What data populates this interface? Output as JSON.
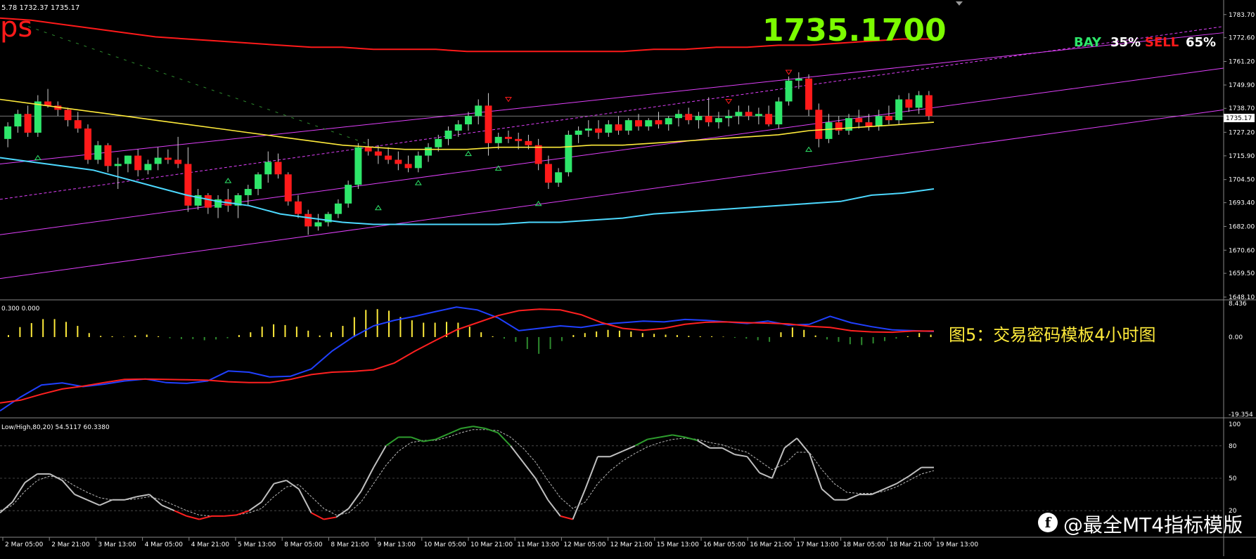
{
  "header": {
    "ohlc_text": "5.78 1732.37 1735.17",
    "brand_fragment": "ps",
    "current_price": "1735.1700",
    "bay_label": "BAY",
    "bay_value": "35%",
    "sell_label": "SELL",
    "sell_value": "65%",
    "price_tag": "1735.17"
  },
  "macd_panel": {
    "header": "0.300 0.000",
    "caption": "图5：交易密码模板4小时图"
  },
  "stoch_panel": {
    "header": "Low/High,80,20) 54.5117 60.3380"
  },
  "watermark": {
    "logo_glyph": "f",
    "text": "@最全MT4指标模版"
  },
  "colors": {
    "bull": "#2ee66a",
    "bear": "#ff1a1a",
    "ma_red": "#ff1a1a",
    "ma_yellow": "#ffeb3b",
    "ma_cyan": "#4dd9ff",
    "channel": "#e040fb",
    "price_big": "#7cfc00",
    "macd_hist": "#ffeb3b",
    "macd_hist_neg": "#2e8b2e",
    "macd_signal": "#ff2020",
    "macd_line": "#2040ff",
    "stoch_main": "#c0c0c0",
    "stoch_over": "#2e9e2e",
    "stoch_under": "#ff2020"
  },
  "chart_data": [
    {
      "type": "candlestick",
      "price_axis": [
        "1783.70",
        "1772.60",
        "1761.20",
        "1749.90",
        "1738.70",
        "1727.20",
        "1715.90",
        "1704.50",
        "1693.40",
        "1682.00",
        "1670.60",
        "1659.50",
        "1648.10"
      ],
      "ylim": [
        1648.1,
        1788.0
      ],
      "time_axis": [
        "2 Mar 05:00",
        "2 Mar 21:00",
        "3 Mar 13:00",
        "4 Mar 05:00",
        "4 Mar 21:00",
        "5 Mar 13:00",
        "8 Mar 05:00",
        "8 Mar 21:00",
        "9 Mar 13:00",
        "10 Mar 05:00",
        "10 Mar 21:00",
        "11 Mar 13:00",
        "12 Mar 05:00",
        "12 Mar 21:00",
        "15 Mar 13:00",
        "16 Mar 05:00",
        "16 Mar 21:00",
        "17 Mar 13:00",
        "18 Mar 05:00",
        "18 Mar 21:00",
        "19 Mar 13:00"
      ],
      "candles_ohlc": [
        [
          1724,
          1732,
          1720,
          1730
        ],
        [
          1730,
          1738,
          1727,
          1736
        ],
        [
          1736,
          1740,
          1725,
          1727
        ],
        [
          1727,
          1745,
          1725,
          1742
        ],
        [
          1742,
          1748,
          1739,
          1740
        ],
        [
          1740,
          1742,
          1735,
          1738
        ],
        [
          1738,
          1739,
          1730,
          1733
        ],
        [
          1733,
          1737,
          1727,
          1729
        ],
        [
          1729,
          1731,
          1712,
          1714
        ],
        [
          1714,
          1723,
          1712,
          1721
        ],
        [
          1721,
          1722,
          1708,
          1711
        ],
        [
          1711,
          1715,
          1700,
          1712
        ],
        [
          1712,
          1716,
          1708,
          1716
        ],
        [
          1716,
          1719,
          1706,
          1709
        ],
        [
          1709,
          1714,
          1707,
          1712
        ],
        [
          1712,
          1720,
          1709,
          1715
        ],
        [
          1715,
          1719,
          1712,
          1714
        ],
        [
          1714,
          1725,
          1710,
          1712
        ],
        [
          1712,
          1720,
          1689,
          1692
        ],
        [
          1692,
          1700,
          1690,
          1697
        ],
        [
          1697,
          1698,
          1688,
          1691
        ],
        [
          1691,
          1697,
          1686,
          1695
        ],
        [
          1695,
          1700,
          1689,
          1692
        ],
        [
          1692,
          1698,
          1686,
          1697
        ],
        [
          1697,
          1702,
          1692,
          1700
        ],
        [
          1700,
          1708,
          1697,
          1707
        ],
        [
          1707,
          1718,
          1703,
          1713
        ],
        [
          1713,
          1717,
          1705,
          1707
        ],
        [
          1707,
          1708,
          1692,
          1694
        ],
        [
          1694,
          1697,
          1686,
          1688
        ],
        [
          1688,
          1690,
          1678,
          1682
        ],
        [
          1682,
          1688,
          1680,
          1684
        ],
        [
          1684,
          1689,
          1682,
          1688
        ],
        [
          1688,
          1695,
          1686,
          1693
        ],
        [
          1693,
          1704,
          1691,
          1702
        ],
        [
          1702,
          1722,
          1700,
          1720
        ],
        [
          1720,
          1724,
          1716,
          1718
        ],
        [
          1718,
          1721,
          1712,
          1716
        ],
        [
          1716,
          1720,
          1712,
          1714
        ],
        [
          1714,
          1718,
          1709,
          1712
        ],
        [
          1712,
          1716,
          1708,
          1710
        ],
        [
          1710,
          1718,
          1708,
          1716
        ],
        [
          1716,
          1722,
          1713,
          1720
        ],
        [
          1720,
          1726,
          1718,
          1724
        ],
        [
          1724,
          1730,
          1721,
          1728
        ],
        [
          1728,
          1733,
          1725,
          1731
        ],
        [
          1731,
          1737,
          1728,
          1735
        ],
        [
          1735,
          1743,
          1731,
          1740
        ],
        [
          1740,
          1746,
          1716,
          1722
        ],
        [
          1722,
          1727,
          1719,
          1725
        ],
        [
          1725,
          1728,
          1722,
          1724
        ],
        [
          1724,
          1727,
          1719,
          1723
        ],
        [
          1723,
          1726,
          1719,
          1721
        ],
        [
          1721,
          1724,
          1709,
          1712
        ],
        [
          1712,
          1716,
          1700,
          1703
        ],
        [
          1703,
          1710,
          1701,
          1708
        ],
        [
          1708,
          1728,
          1706,
          1726
        ],
        [
          1726,
          1730,
          1722,
          1728
        ],
        [
          1728,
          1733,
          1725,
          1729
        ],
        [
          1729,
          1733,
          1724,
          1727
        ],
        [
          1727,
          1733,
          1725,
          1731
        ],
        [
          1731,
          1735,
          1726,
          1728
        ],
        [
          1728,
          1734,
          1726,
          1733
        ],
        [
          1733,
          1736,
          1728,
          1730
        ],
        [
          1730,
          1734,
          1728,
          1733
        ],
        [
          1733,
          1737,
          1729,
          1731
        ],
        [
          1731,
          1735,
          1728,
          1734
        ],
        [
          1734,
          1738,
          1730,
          1736
        ],
        [
          1736,
          1739,
          1731,
          1733
        ],
        [
          1733,
          1737,
          1729,
          1735
        ],
        [
          1735,
          1744,
          1730,
          1732
        ],
        [
          1732,
          1737,
          1729,
          1734
        ],
        [
          1734,
          1738,
          1730,
          1735
        ],
        [
          1735,
          1740,
          1731,
          1737
        ],
        [
          1737,
          1740,
          1733,
          1735
        ],
        [
          1735,
          1739,
          1731,
          1736
        ],
        [
          1736,
          1740,
          1730,
          1731
        ],
        [
          1731,
          1744,
          1729,
          1742
        ],
        [
          1742,
          1754,
          1740,
          1752
        ],
        [
          1752,
          1756,
          1748,
          1753
        ],
        [
          1753,
          1755,
          1735,
          1738
        ],
        [
          1738,
          1741,
          1720,
          1724
        ],
        [
          1724,
          1736,
          1722,
          1732
        ],
        [
          1732,
          1735,
          1726,
          1728
        ],
        [
          1728,
          1736,
          1726,
          1734
        ],
        [
          1734,
          1738,
          1729,
          1732
        ],
        [
          1732,
          1736,
          1728,
          1730
        ],
        [
          1730,
          1738,
          1728,
          1735
        ],
        [
          1735,
          1740,
          1731,
          1733
        ],
        [
          1733,
          1745,
          1731,
          1743
        ],
        [
          1743,
          1746,
          1737,
          1739
        ],
        [
          1739,
          1747,
          1736,
          1745
        ],
        [
          1745,
          1747,
          1733,
          1735
        ]
      ],
      "series": [
        {
          "indicator": "ma_red",
          "values": [
            1782,
            1781,
            1779,
            1777,
            1775,
            1773,
            1772,
            1771,
            1770,
            1769,
            1768,
            1768,
            1767,
            1767,
            1767,
            1766,
            1766,
            1766,
            1766,
            1766,
            1766,
            1767,
            1767,
            1768,
            1768,
            1769,
            1769,
            1770,
            1771,
            1772,
            1772
          ]
        },
        {
          "indicator": "ma_yellow",
          "values": [
            1743,
            1741,
            1739,
            1737,
            1735,
            1733,
            1731,
            1729,
            1727,
            1725,
            1723,
            1721,
            1720,
            1719,
            1719,
            1719,
            1720,
            1720,
            1720,
            1721,
            1721,
            1722,
            1723,
            1724,
            1725,
            1726,
            1728,
            1729,
            1730,
            1731,
            1732
          ]
        },
        {
          "indicator": "ma_cyan",
          "values": [
            1715,
            1713,
            1711,
            1709,
            1705,
            1701,
            1697,
            1694,
            1692,
            1688,
            1686,
            1684,
            1683,
            1683,
            1683,
            1683,
            1683,
            1684,
            1684,
            1685,
            1686,
            1688,
            1689,
            1690,
            1691,
            1692,
            1693,
            1694,
            1697,
            1698,
            1700
          ]
        }
      ]
    },
    {
      "type": "bar",
      "ylim": [
        -19.354,
        8.436
      ],
      "axis_labels": [
        "8.436",
        "0.00",
        "-19.354"
      ],
      "histogram": [
        0.5,
        2.5,
        3.5,
        4.5,
        4.5,
        3.8,
        2.8,
        1.0,
        0.3,
        0.2,
        0.1,
        0.4,
        0.6,
        0.2,
        -0.3,
        -0.5,
        -0.5,
        -0.8,
        -0.6,
        -0.3,
        0.5,
        1.2,
        2.6,
        3.2,
        3.0,
        2.6,
        1.6,
        0.4,
        1.2,
        2.8,
        5.0,
        6.8,
        7.0,
        6.6,
        5.0,
        4.2,
        3.6,
        3.6,
        3.8,
        3.6,
        2.6,
        1.2,
        0.2,
        -0.4,
        -1.2,
        -3.0,
        -4.2,
        -3.0,
        -1.0,
        0.5,
        1.0,
        1.4,
        1.8,
        1.6,
        1.4,
        1.0,
        0.8,
        0.6,
        0.5,
        0.3,
        0.2,
        0.2,
        0.1,
        -0.2,
        -0.4,
        -0.8,
        -1.2,
        1.2,
        2.4,
        1.8,
        0.4,
        -0.6,
        -1.2,
        -1.8,
        -2.0,
        -1.6,
        -1.0,
        -0.4,
        0.2,
        1.0,
        0.6
      ],
      "series": [
        {
          "indicator": "macd_signal",
          "values": [
            -16.5,
            -15.8,
            -14.3,
            -13.0,
            -12.3,
            -11.4,
            -10.6,
            -10.5,
            -10.6,
            -10.7,
            -10.8,
            -11.2,
            -11.4,
            -11.4,
            -10.6,
            -9.4,
            -8.8,
            -8.6,
            -8.2,
            -6.5,
            -3.5,
            -0.8,
            1.8,
            3.6,
            5.4,
            6.6,
            7.0,
            6.8,
            5.6,
            3.6,
            2.2,
            1.7,
            2.2,
            3.2,
            3.7,
            3.8,
            3.6,
            3.5,
            3.3,
            2.7,
            2.4,
            1.6,
            1.3,
            1.2,
            1.5,
            1.5
          ]
        },
        {
          "indicator": "macd_line",
          "values": [
            -18.5,
            -15.0,
            -12.0,
            -11.5,
            -12.4,
            -11.8,
            -11.0,
            -10.5,
            -11.4,
            -11.6,
            -11.0,
            -8.5,
            -8.8,
            -10.0,
            -9.8,
            -8.0,
            -3.5,
            0.0,
            2.8,
            4.2,
            5.2,
            6.4,
            7.5,
            6.8,
            4.8,
            1.6,
            2.2,
            2.8,
            2.4,
            3.2,
            3.6,
            4.0,
            3.8,
            4.4,
            4.2,
            3.8,
            3.4,
            4.0,
            3.0,
            3.2,
            5.2,
            3.6,
            2.6,
            1.8,
            1.6,
            1.4
          ]
        }
      ]
    },
    {
      "type": "line",
      "ylim": [
        0,
        100
      ],
      "axis_labels": [
        "100",
        "80",
        "50",
        "20"
      ],
      "series": [
        {
          "indicator": "stoch_main",
          "values": [
            18,
            28,
            46,
            54,
            54,
            48,
            35,
            30,
            25,
            30,
            30,
            33,
            35,
            25,
            20,
            15,
            12,
            15,
            15,
            16,
            20,
            28,
            45,
            48,
            40,
            18,
            12,
            14,
            22,
            38,
            60,
            80,
            88,
            88,
            84,
            86,
            91,
            96,
            98,
            96,
            92,
            80,
            65,
            50,
            30,
            15,
            12,
            40,
            70,
            70,
            75,
            80,
            86,
            88,
            90,
            88,
            85,
            78,
            78,
            72,
            70,
            55,
            50,
            78,
            87,
            73,
            40,
            30,
            30,
            35,
            35,
            40,
            45,
            52,
            60,
            60
          ]
        },
        {
          "indicator": "stoch_signal",
          "values": [
            20,
            25,
            38,
            48,
            52,
            50,
            43,
            37,
            32,
            30,
            30,
            31,
            33,
            30,
            25,
            20,
            16,
            15,
            15,
            16,
            18,
            22,
            33,
            42,
            44,
            33,
            22,
            16,
            18,
            28,
            45,
            62,
            75,
            83,
            85,
            85,
            88,
            92,
            95,
            95,
            94,
            88,
            78,
            65,
            48,
            32,
            22,
            28,
            45,
            57,
            66,
            73,
            79,
            83,
            86,
            87,
            86,
            83,
            81,
            77,
            74,
            66,
            58,
            63,
            74,
            74,
            58,
            45,
            37,
            36,
            36,
            38,
            42,
            48,
            54,
            57
          ]
        }
      ]
    }
  ]
}
